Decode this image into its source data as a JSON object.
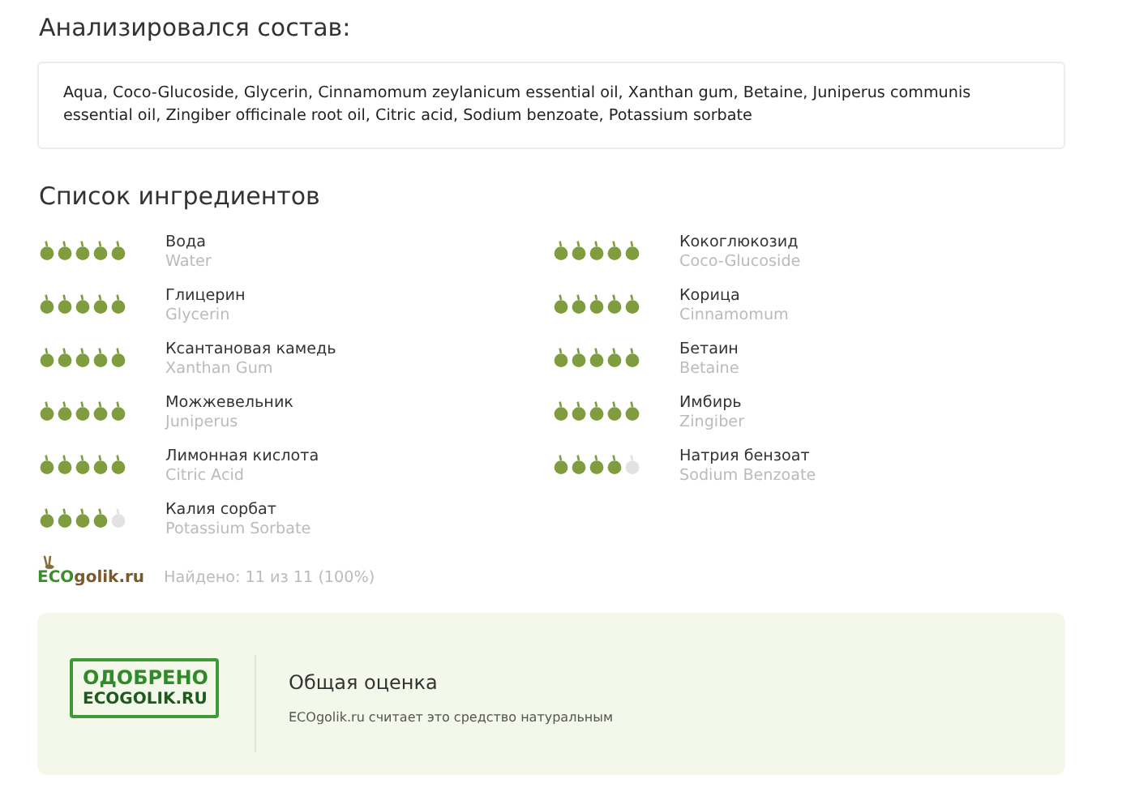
{
  "composition": {
    "title": "Анализировался состав:",
    "text": "Aqua, Coco-Glucoside, Glycerin, Cinnamomum zeylanicum essential oil, Xanthan gum, Betaine, Juniperus communis essential oil, Zingiber officinale root oil, Citric acid, Sodium benzoate, Potassium sorbate"
  },
  "ingredients": {
    "title": "Список ингредиентов",
    "items": [
      {
        "name": "Вода",
        "latin": "Water",
        "stars": 5
      },
      {
        "name": "Кокоглюкозид",
        "latin": "Coco-Glucoside",
        "stars": 5
      },
      {
        "name": "Глицерин",
        "latin": "Glycerin",
        "stars": 5
      },
      {
        "name": "Корица",
        "latin": "Cinnamomum",
        "stars": 5
      },
      {
        "name": "Ксантановая камедь",
        "latin": "Xanthan Gum",
        "stars": 5
      },
      {
        "name": "Бетаин",
        "latin": "Betaine",
        "stars": 5
      },
      {
        "name": "Можжевельник",
        "latin": "Juniperus",
        "stars": 5
      },
      {
        "name": "Имбирь",
        "latin": "Zingiber",
        "stars": 5
      },
      {
        "name": "Лимонная кислота",
        "latin": "Citric Acid",
        "stars": 5
      },
      {
        "name": "Натрия бензоат",
        "latin": "Sodium Benzoate",
        "stars": 4
      },
      {
        "name": "Калия сорбат",
        "latin": "Potassium Sorbate",
        "stars": 4
      }
    ],
    "logo": {
      "prefix": "ECO",
      "suffix": "golik.ru"
    },
    "found": "Найдено: 11 из 11 (100%)"
  },
  "verdict": {
    "stamp": [
      "ОДОБРЕНО",
      "ECOGOLIK.RU"
    ],
    "title": "Общая оценка",
    "text": "ECOgolik.ru считает это средство натуральным"
  }
}
